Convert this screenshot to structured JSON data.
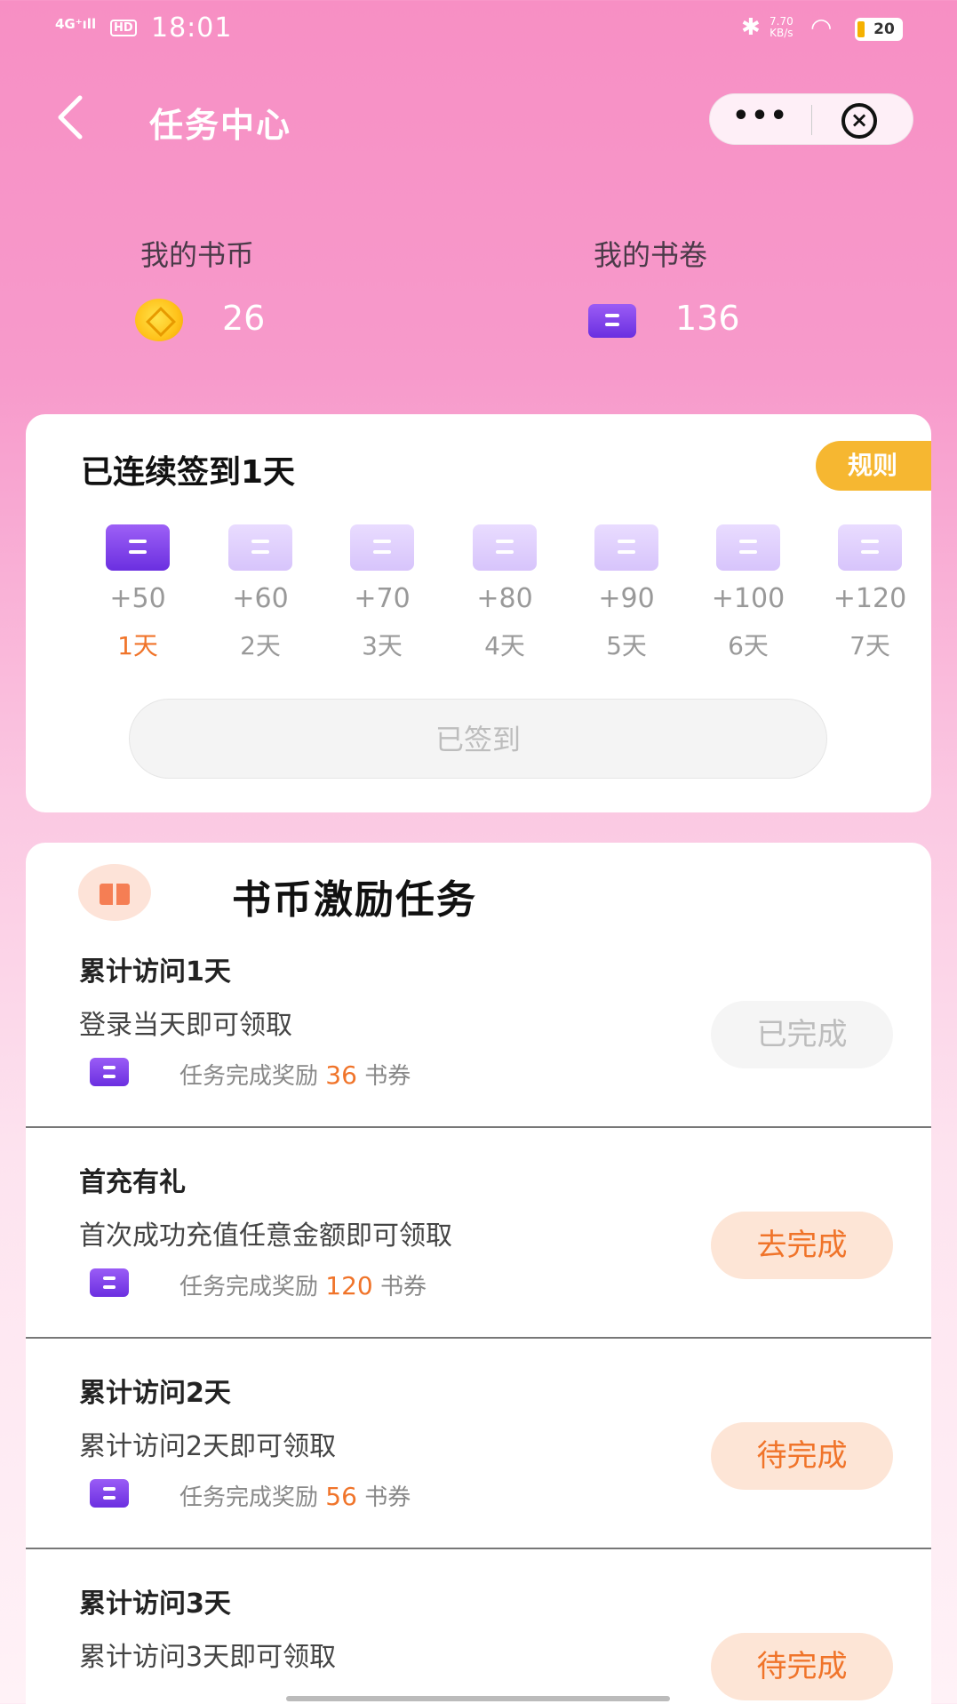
{
  "status_bar": {
    "signal": "4G⁺ıll",
    "hd": "HD",
    "time": "18:01",
    "bluetooth": "✱",
    "speed_value": "7.70",
    "speed_unit": "KB/s",
    "wifi": "◠",
    "battery": "20"
  },
  "nav": {
    "title": "任务中心",
    "more": "•••",
    "close": "×"
  },
  "wallet": {
    "coins_label": "我的书币",
    "coins_value": "26",
    "tickets_label": "我的书卷",
    "tickets_value": "136"
  },
  "signin": {
    "title": "已连续签到1天",
    "rule_label": "规则",
    "days": [
      {
        "points": "+50",
        "label": "1天",
        "active": true
      },
      {
        "points": "+60",
        "label": "2天",
        "active": false
      },
      {
        "points": "+70",
        "label": "3天",
        "active": false
      },
      {
        "points": "+80",
        "label": "4天",
        "active": false
      },
      {
        "points": "+90",
        "label": "5天",
        "active": false
      },
      {
        "points": "+100",
        "label": "6天",
        "active": false
      },
      {
        "points": "+120",
        "label": "7天",
        "active": false
      }
    ],
    "button_label": "已签到"
  },
  "tasks": {
    "title": "书币激励任务",
    "items": [
      {
        "title": "累计访问1天",
        "desc": "登录当天即可领取",
        "reward_prefix": "任务完成奖励",
        "reward_value": "36",
        "reward_unit": "书券",
        "button": "已完成",
        "status": "done"
      },
      {
        "title": "首充有礼",
        "desc": "首次成功充值任意金额即可领取",
        "reward_prefix": "任务完成奖励",
        "reward_value": "120",
        "reward_unit": "书券",
        "button": "去完成",
        "status": "todo"
      },
      {
        "title": "累计访问2天",
        "desc": "累计访问2天即可领取",
        "reward_prefix": "任务完成奖励",
        "reward_value": "56",
        "reward_unit": "书券",
        "button": "待完成",
        "status": "todo"
      },
      {
        "title": "累计访问3天",
        "desc": "累计访问3天即可领取",
        "reward_prefix": "",
        "reward_value": "",
        "reward_unit": "",
        "button": "待完成",
        "status": "todo"
      }
    ]
  },
  "colors": {
    "accent_orange": "#f0742a",
    "ticket_purple": "#7a3ae8",
    "rule_yellow": "#f6b731",
    "header_pink": "#f78fc4"
  }
}
